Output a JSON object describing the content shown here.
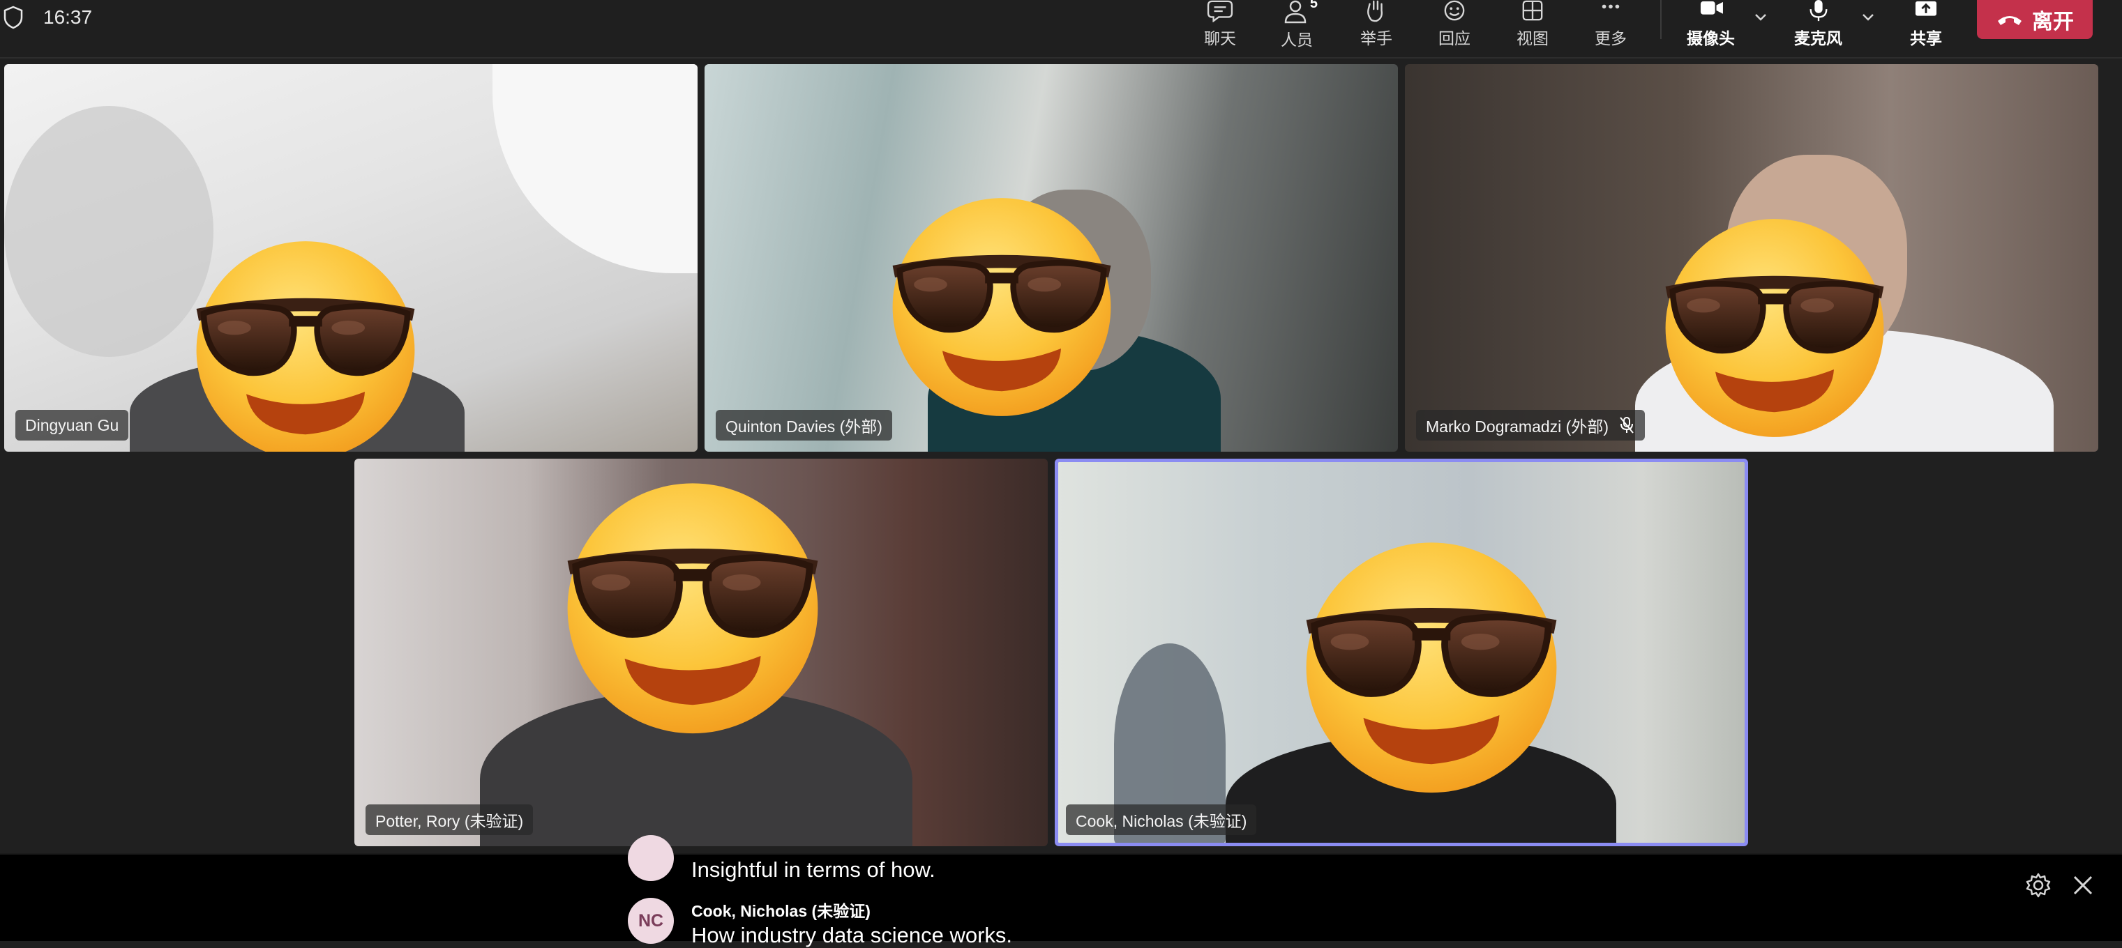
{
  "status": {
    "time": "16:37"
  },
  "toolbar": {
    "chat": "聊天",
    "people": "人员",
    "people_count": "5",
    "raise_hand": "举手",
    "react": "回应",
    "view": "视图",
    "more": "更多",
    "camera": "摄像头",
    "mic": "麦克风",
    "share": "共享",
    "leave": "离开",
    "leave_color": "#c4314b"
  },
  "participants": [
    {
      "name": "Dingyuan Gu"
    },
    {
      "name": "Quinton Davies (外部)"
    },
    {
      "name": "Marko Dogramadzi (外部)",
      "muted": true
    },
    {
      "name": "Potter, Rory (未验证)"
    },
    {
      "name": "Cook, Nicholas (未验证)",
      "active_speaker": true,
      "highlight_color": "#8b8cf2"
    }
  ],
  "captions": {
    "line1_text": "Insightful in terms of how.",
    "line2_initials": "NC",
    "line2_speaker": "Cook, Nicholas (未验证)",
    "line2_text": "How industry data science works."
  }
}
